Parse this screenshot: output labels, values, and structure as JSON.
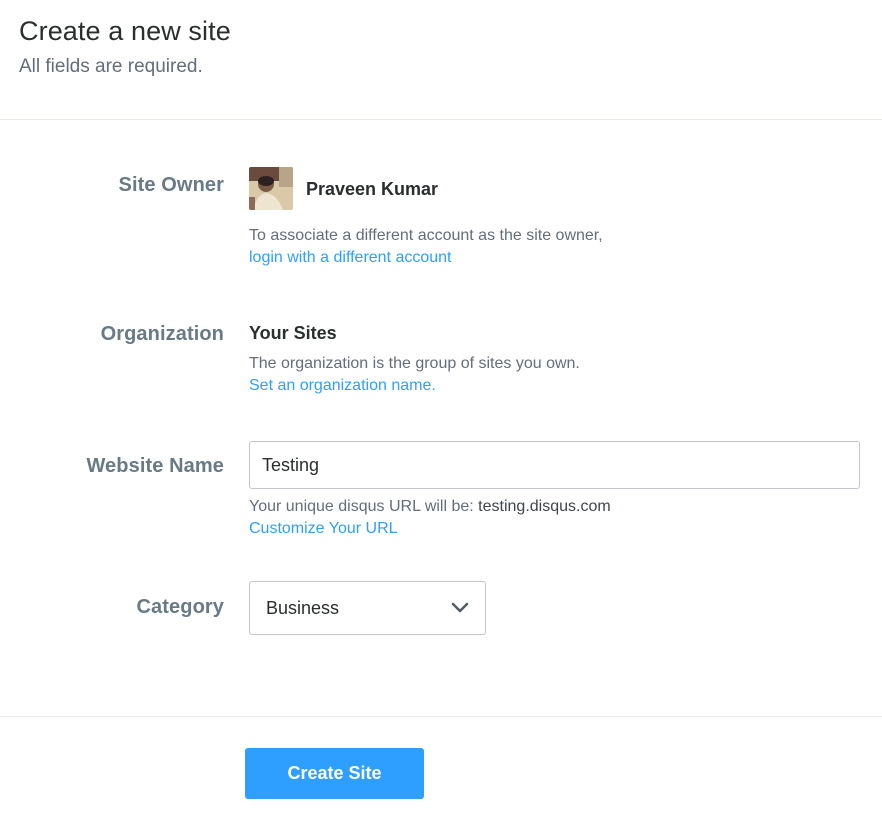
{
  "header": {
    "title": "Create a new site",
    "subtitle": "All fields are required."
  },
  "owner": {
    "label": "Site Owner",
    "name": "Praveen Kumar",
    "help_text": "To associate a different account as the site owner,",
    "link_text": "login with a different account"
  },
  "organization": {
    "label": "Organization",
    "value": "Your Sites",
    "help_text": "The organization is the group of sites you own.",
    "link_text": "Set an organization name."
  },
  "website": {
    "label": "Website Name",
    "value": "Testing",
    "url_prefix": "Your unique disqus URL will be: ",
    "url_value": "testing.disqus.com",
    "link_text": "Customize Your URL"
  },
  "category": {
    "label": "Category",
    "selected": "Business"
  },
  "actions": {
    "create_label": "Create Site"
  },
  "colors": {
    "accent": "#2e9fff",
    "label": "#687a86",
    "muted_text": "#656c7a"
  }
}
